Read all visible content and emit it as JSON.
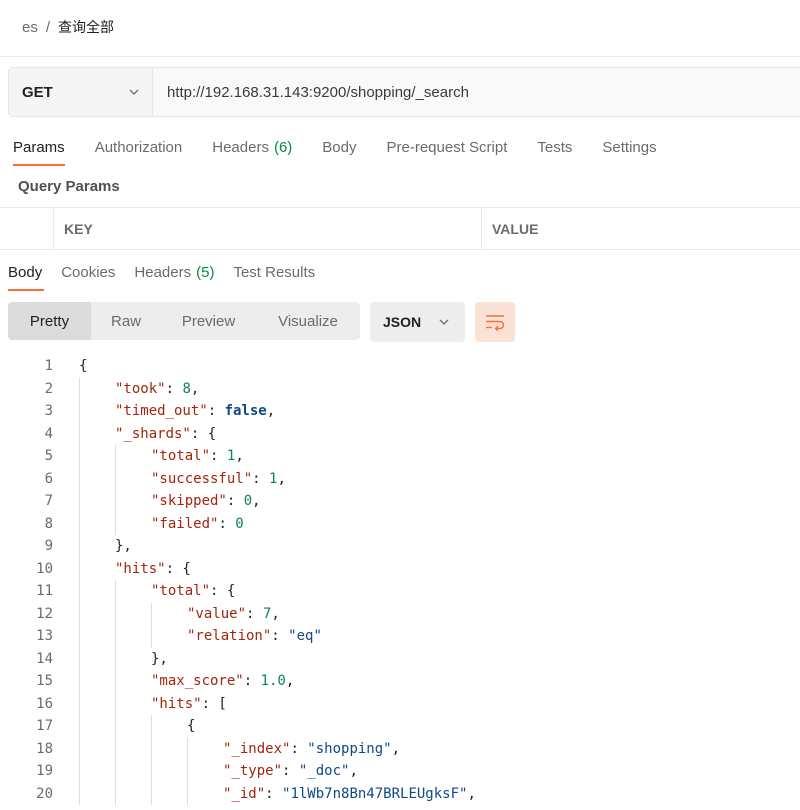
{
  "breadcrumb": {
    "parent": "es",
    "separator": "/",
    "current": "查询全部"
  },
  "request": {
    "method": "GET",
    "url": "http://192.168.31.143:9200/shopping/_search"
  },
  "request_tabs": [
    {
      "label": "Params",
      "active": true
    },
    {
      "label": "Authorization"
    },
    {
      "label": "Headers",
      "count": "(6)"
    },
    {
      "label": "Body"
    },
    {
      "label": "Pre-request Script"
    },
    {
      "label": "Tests"
    },
    {
      "label": "Settings"
    }
  ],
  "query_params": {
    "title": "Query Params",
    "key_header": "KEY",
    "value_header": "VALUE"
  },
  "response_tabs": [
    {
      "label": "Body",
      "active": true
    },
    {
      "label": "Cookies"
    },
    {
      "label": "Headers",
      "count": "(5)"
    },
    {
      "label": "Test Results"
    }
  ],
  "view_modes": [
    "Pretty",
    "Raw",
    "Preview",
    "Visualize"
  ],
  "format": "JSON",
  "icons": {
    "method_dropdown": "chevron-down-icon",
    "format_dropdown": "chevron-down-icon",
    "wrap": "wrap-lines-icon"
  },
  "colors": {
    "accent": "#ff6c37",
    "count": "#0a8a43",
    "json_key": "#a1260d",
    "json_string": "#0f4a85",
    "json_number": "#098658"
  },
  "code_lines": [
    {
      "n": "1",
      "indent": 0,
      "tokens": [
        [
          "punct",
          "{"
        ]
      ]
    },
    {
      "n": "2",
      "indent": 1,
      "tokens": [
        [
          "key",
          "\"took\""
        ],
        [
          "punct",
          ": "
        ],
        [
          "num",
          "8"
        ],
        [
          "punct",
          ","
        ]
      ]
    },
    {
      "n": "3",
      "indent": 1,
      "tokens": [
        [
          "key",
          "\"timed_out\""
        ],
        [
          "punct",
          ": "
        ],
        [
          "kw",
          "false"
        ],
        [
          "punct",
          ","
        ]
      ]
    },
    {
      "n": "4",
      "indent": 1,
      "tokens": [
        [
          "key",
          "\"_shards\""
        ],
        [
          "punct",
          ": {"
        ]
      ]
    },
    {
      "n": "5",
      "indent": 2,
      "tokens": [
        [
          "key",
          "\"total\""
        ],
        [
          "punct",
          ": "
        ],
        [
          "num",
          "1"
        ],
        [
          "punct",
          ","
        ]
      ]
    },
    {
      "n": "6",
      "indent": 2,
      "tokens": [
        [
          "key",
          "\"successful\""
        ],
        [
          "punct",
          ": "
        ],
        [
          "num",
          "1"
        ],
        [
          "punct",
          ","
        ]
      ]
    },
    {
      "n": "7",
      "indent": 2,
      "tokens": [
        [
          "key",
          "\"skipped\""
        ],
        [
          "punct",
          ": "
        ],
        [
          "num",
          "0"
        ],
        [
          "punct",
          ","
        ]
      ]
    },
    {
      "n": "8",
      "indent": 2,
      "tokens": [
        [
          "key",
          "\"failed\""
        ],
        [
          "punct",
          ": "
        ],
        [
          "num",
          "0"
        ]
      ]
    },
    {
      "n": "9",
      "indent": 1,
      "tokens": [
        [
          "punct",
          "},"
        ]
      ]
    },
    {
      "n": "10",
      "indent": 1,
      "tokens": [
        [
          "key",
          "\"hits\""
        ],
        [
          "punct",
          ": {"
        ]
      ]
    },
    {
      "n": "11",
      "indent": 2,
      "tokens": [
        [
          "key",
          "\"total\""
        ],
        [
          "punct",
          ": {"
        ]
      ]
    },
    {
      "n": "12",
      "indent": 3,
      "tokens": [
        [
          "key",
          "\"value\""
        ],
        [
          "punct",
          ": "
        ],
        [
          "num",
          "7"
        ],
        [
          "punct",
          ","
        ]
      ]
    },
    {
      "n": "13",
      "indent": 3,
      "tokens": [
        [
          "key",
          "\"relation\""
        ],
        [
          "punct",
          ": "
        ],
        [
          "str",
          "\"eq\""
        ]
      ]
    },
    {
      "n": "14",
      "indent": 2,
      "tokens": [
        [
          "punct",
          "},"
        ]
      ]
    },
    {
      "n": "15",
      "indent": 2,
      "tokens": [
        [
          "key",
          "\"max_score\""
        ],
        [
          "punct",
          ": "
        ],
        [
          "num",
          "1.0"
        ],
        [
          "punct",
          ","
        ]
      ]
    },
    {
      "n": "16",
      "indent": 2,
      "tokens": [
        [
          "key",
          "\"hits\""
        ],
        [
          "punct",
          ": ["
        ]
      ]
    },
    {
      "n": "17",
      "indent": 3,
      "tokens": [
        [
          "punct",
          "{"
        ]
      ]
    },
    {
      "n": "18",
      "indent": 4,
      "tokens": [
        [
          "key",
          "\"_index\""
        ],
        [
          "punct",
          ": "
        ],
        [
          "str",
          "\"shopping\""
        ],
        [
          "punct",
          ","
        ]
      ]
    },
    {
      "n": "19",
      "indent": 4,
      "tokens": [
        [
          "key",
          "\"_type\""
        ],
        [
          "punct",
          ": "
        ],
        [
          "str",
          "\"_doc\""
        ],
        [
          "punct",
          ","
        ]
      ]
    },
    {
      "n": "20",
      "indent": 4,
      "tokens": [
        [
          "key",
          "\"_id\""
        ],
        [
          "punct",
          ": "
        ],
        [
          "str",
          "\"1lWb7n8Bn47BRLEUgksF\""
        ],
        [
          "punct",
          ","
        ]
      ]
    }
  ]
}
